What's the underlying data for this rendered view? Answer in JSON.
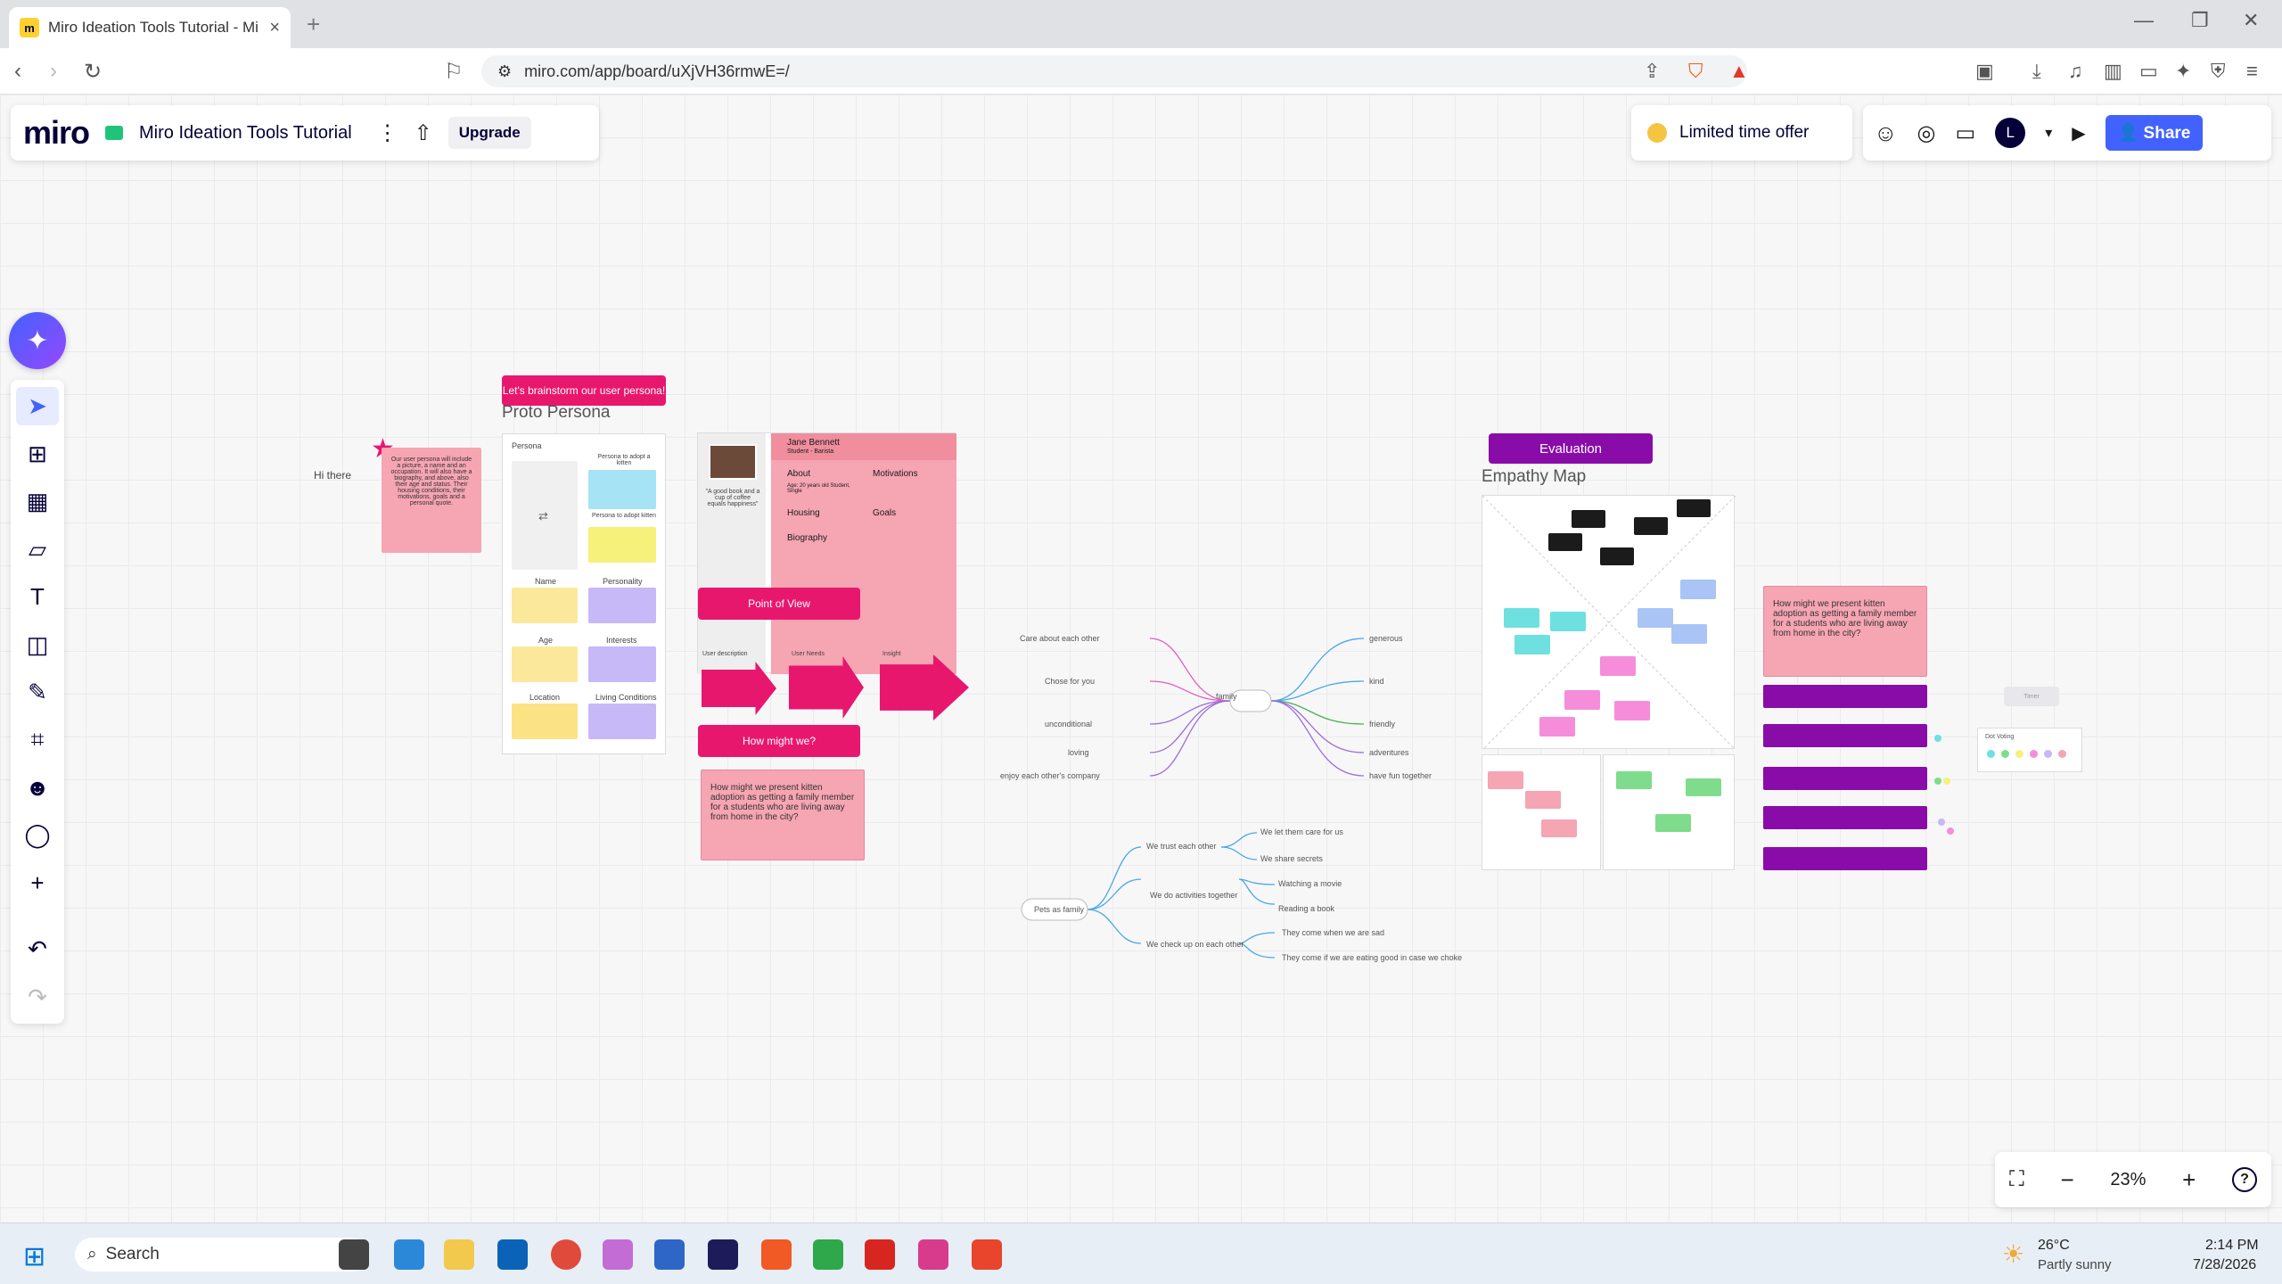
{
  "browser": {
    "tab_title": "Miro Ideation Tools Tutorial - Mi",
    "tab_favicon": "miro-icon",
    "url": "miro.com/app/board/uXjVH36rmwE=/"
  },
  "miro_header": {
    "logo": "miro",
    "board_title": "Miro Ideation Tools Tutorial",
    "upgrade_label": "Upgrade",
    "offer_label": "Limited time offer",
    "avatar_letter": "L",
    "share_label": "Share"
  },
  "board": {
    "hi_there": "Hi there",
    "intro_note": "Our user persona will include a picture, a name and an occupation. It will also have a biography, and above, also their age and status. Their housing conditions, their motivations, goals and a personal quote.",
    "lets_brainstorm": "Let's brainstorm our user persona!",
    "proto_persona_title": "Proto Persona",
    "persona_label": "Persona",
    "persona_to_adopt": "Persona to adopt a kitten",
    "persona_to_adopt_sub": "Persona to adopt kitten",
    "name_label": "Name",
    "personality_label": "Personality",
    "age_label": "Age",
    "interests_label": "Interests",
    "location_label": "Location",
    "living_conditions_label": "Living Conditions",
    "jane_name": "Jane Bennett",
    "jane_role": "Student - Barista",
    "jane_quote": "\"A good book and a cup of coffee equals happiness\"",
    "about_label": "About",
    "about_text": "Age: 20 years old Student, Single",
    "motivations_label": "Motivations",
    "housing_label": "Housing",
    "goals_label": "Goals",
    "biography_label": "Biography",
    "point_of_view": "Point of View",
    "pov_user": "User description",
    "pov_needs": "User Needs",
    "pov_insight": "Insight",
    "how_might_we": "How might we?",
    "hmw_question": "How might we present kitten adoption as getting a family member for a students who are living away from home in the city?",
    "evaluation": "Evaluation",
    "empathy_map_title": "Empathy Map",
    "mindmap_center": "family",
    "mindmap_left": [
      "Care about each other",
      "Chose for you",
      "unconditional",
      "loving",
      "enjoy each other's company"
    ],
    "mindmap_right": [
      "generous",
      "kind",
      "friendly",
      "adventures",
      "have fun together"
    ],
    "mindmap2_center": "Pets as family",
    "mindmap2_branches": [
      "We trust each other",
      "We do activities together",
      "We check up on each other"
    ],
    "mindmap2_leaves": [
      "We let them care for us",
      "We share secrets",
      "Watching a movie",
      "Reading a book",
      "They come when we are sad",
      "They come if we are eating good in case we choke"
    ],
    "timer_label": "Timer",
    "dot_voting_label": "Dot Voting"
  },
  "zoom": {
    "level": "23%"
  },
  "taskbar": {
    "search_placeholder": "Search",
    "weather_temp": "26°C",
    "weather_desc": "Partly sunny",
    "time": "2:14 PM",
    "date": "7/28/2026"
  }
}
